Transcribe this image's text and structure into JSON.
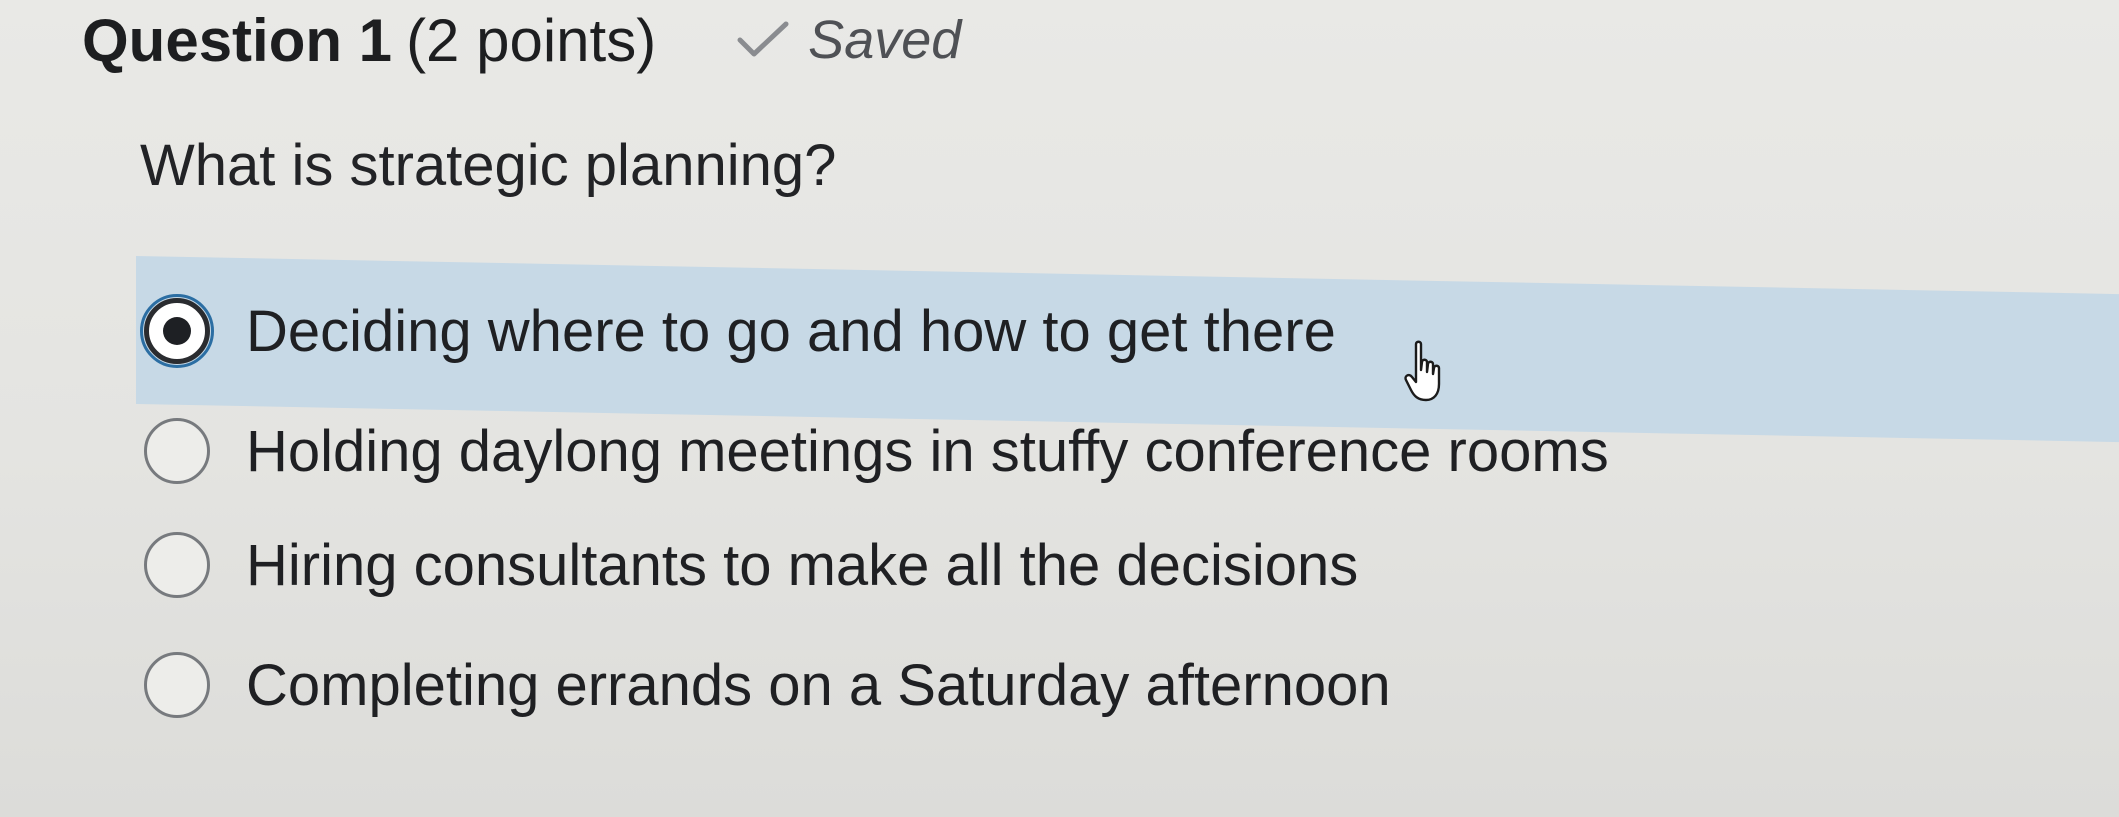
{
  "question": {
    "title": "Question 1",
    "points": "(2 points)",
    "status": "Saved",
    "status_icon": "checkmark-icon",
    "prompt": "What is strategic planning?"
  },
  "options": [
    {
      "label": "Deciding where to go and how to get there",
      "selected": true
    },
    {
      "label": "Holding daylong meetings in stuffy conference rooms",
      "selected": false
    },
    {
      "label": "Hiring consultants to make all the decisions",
      "selected": false
    },
    {
      "label": "Completing errands on a Saturday afternoon",
      "selected": false
    }
  ],
  "colors": {
    "highlight": "#c7d9e6",
    "focus_ring": "#2b6ea3",
    "background": "#e7e7e4"
  },
  "cursor_icon": "hand-pointer-icon"
}
